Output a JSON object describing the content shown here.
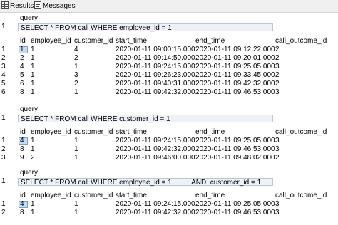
{
  "tabs": [
    {
      "label": "Results",
      "icon": "grid-icon"
    },
    {
      "label": "Messages",
      "icon": "messages-icon"
    }
  ],
  "sections": [
    {
      "query_header": "query",
      "query_row_num": "1",
      "query": "SELECT * FROM call WHERE employee_id = 1",
      "columns": [
        "id",
        "employee_id",
        "customer_id",
        "start_time",
        "end_time",
        "call_outcome_id"
      ],
      "rows": [
        {
          "rn": "1",
          "cells": [
            "1",
            "1",
            "4",
            "2020-01-11 09:00:15.000",
            "2020-01-11 09:12:22.000",
            "2"
          ]
        },
        {
          "rn": "2",
          "cells": [
            "2",
            "1",
            "2",
            "2020-01-11 09:14:50.000",
            "2020-01-11 09:20:01.000",
            "2"
          ]
        },
        {
          "rn": "3",
          "cells": [
            "4",
            "1",
            "1",
            "2020-01-11 09:24:15.000",
            "2020-01-11 09:25:05.000",
            "3"
          ]
        },
        {
          "rn": "4",
          "cells": [
            "5",
            "1",
            "3",
            "2020-01-11 09:26:23.000",
            "2020-01-11 09:33:45.000",
            "2"
          ]
        },
        {
          "rn": "5",
          "cells": [
            "6",
            "1",
            "2",
            "2020-01-11 09:40:31.000",
            "2020-01-11 09:42:32.000",
            "2"
          ]
        },
        {
          "rn": "6",
          "cells": [
            "8",
            "1",
            "1",
            "2020-01-11 09:42:32.000",
            "2020-01-11 09:46:53.000",
            "3"
          ]
        }
      ]
    },
    {
      "query_header": "query",
      "query_row_num": "1",
      "query": "SELECT * FROM call WHERE customer_id = 1",
      "columns": [
        "id",
        "employee_id",
        "customer_id",
        "start_time",
        "end_time",
        "call_outcome_id"
      ],
      "rows": [
        {
          "rn": "1",
          "cells": [
            "4",
            "1",
            "1",
            "2020-01-11 09:24:15.000",
            "2020-01-11 09:25:05.000",
            "3"
          ]
        },
        {
          "rn": "2",
          "cells": [
            "8",
            "1",
            "1",
            "2020-01-11 09:42:32.000",
            "2020-01-11 09:46:53.000",
            "3"
          ]
        },
        {
          "rn": "3",
          "cells": [
            "9",
            "2",
            "1",
            "2020-01-11 09:46:00.000",
            "2020-01-11 09:48:02.000",
            "2"
          ]
        }
      ]
    },
    {
      "query_header": "query",
      "query_row_num": "1",
      "query": "SELECT * FROM call WHERE employee_id = 1          AND  customer_id = 1",
      "columns": [
        "id",
        "employee_id",
        "customer_id",
        "start_time",
        "end_time",
        "call_outcome_id"
      ],
      "rows": [
        {
          "rn": "1",
          "cells": [
            "4",
            "1",
            "1",
            "2020-01-11 09:24:15.000",
            "2020-01-11 09:25:05.000",
            "3"
          ]
        },
        {
          "rn": "2",
          "cells": [
            "8",
            "1",
            "1",
            "2020-01-11 09:42:32.000",
            "2020-01-11 09:46:53.000",
            "3"
          ]
        }
      ]
    }
  ]
}
